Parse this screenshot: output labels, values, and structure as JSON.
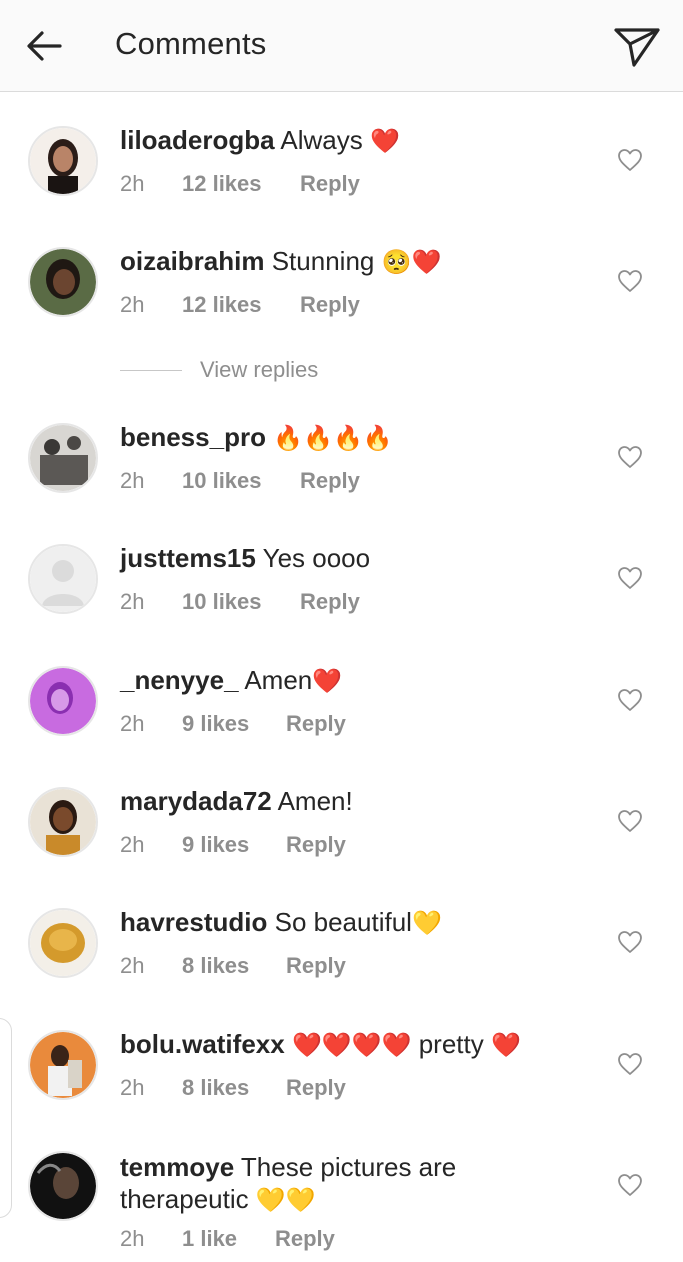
{
  "header": {
    "title": "Comments",
    "back_icon": "arrow-left-icon",
    "share_icon": "paper-plane-icon"
  },
  "view_replies_label": "View replies",
  "comments": [
    {
      "username": "liloaderogba",
      "text": "Always",
      "emoji": "❤️",
      "time": "2h",
      "likes": "12 likes",
      "reply": "Reply",
      "avatar_color": "#3a2a25"
    },
    {
      "username": "oizaibrahim",
      "text": "Stunning",
      "emoji": "🥺❤️",
      "time": "2h",
      "likes": "12 likes",
      "reply": "Reply",
      "avatar_color": "#2b241f"
    },
    {
      "username": "beness_pro",
      "text": "",
      "emoji": "🔥🔥🔥🔥",
      "time": "2h",
      "likes": "10 likes",
      "reply": "Reply",
      "avatar_color": "#6d6a66"
    },
    {
      "username": "justtems15",
      "text": "Yes oooo",
      "emoji": "",
      "time": "2h",
      "likes": "10 likes",
      "reply": "Reply",
      "avatar_color": "#efefef"
    },
    {
      "username": "_nenyye_",
      "text": "Amen",
      "emoji": "❤️",
      "time": "2h",
      "likes": "9 likes",
      "reply": "Reply",
      "avatar_color": "#b44fd9"
    },
    {
      "username": "marydada72",
      "text": "Amen!",
      "emoji": "",
      "time": "2h",
      "likes": "9 likes",
      "reply": "Reply",
      "avatar_color": "#7a4a2c"
    },
    {
      "username": "havrestudio",
      "text": "So beautiful",
      "emoji": "💛",
      "time": "2h",
      "likes": "8 likes",
      "reply": "Reply",
      "avatar_color": "#d49a2c"
    },
    {
      "username": "bolu.watifexx",
      "text": "pretty",
      "emoji_before": "❤️❤️❤️❤️",
      "emoji": "❤️",
      "time": "2h",
      "likes": "8 likes",
      "reply": "Reply",
      "avatar_color": "#e98a3c"
    },
    {
      "username": "temmoye",
      "text": "These pictures are therapeutic",
      "emoji": "💛💛",
      "time": "2h",
      "likes": "1 like",
      "reply": "Reply",
      "avatar_color": "#1d1d1d"
    }
  ]
}
